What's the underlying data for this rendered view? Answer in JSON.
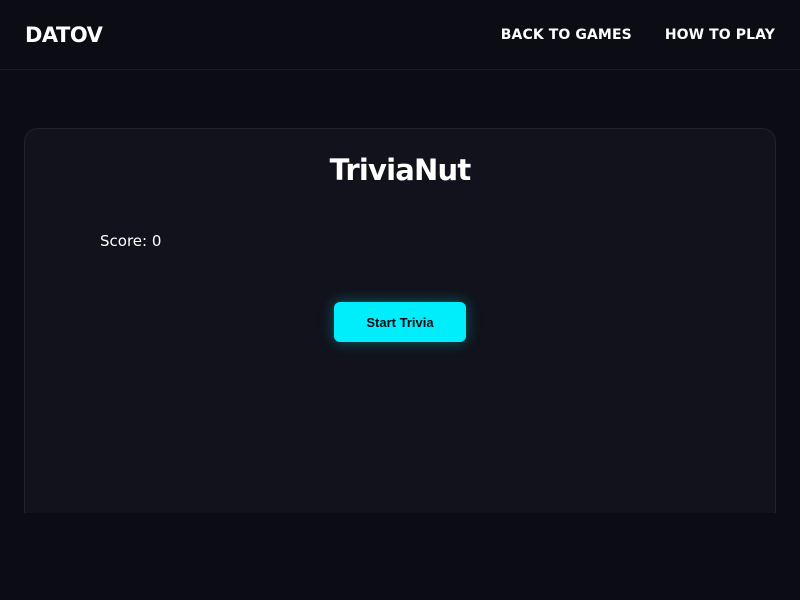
{
  "header": {
    "brand": "DATOV",
    "nav": [
      {
        "label": "BACK TO GAMES"
      },
      {
        "label": "HOW TO PLAY"
      }
    ]
  },
  "game": {
    "title": "TriviaNut",
    "score_label": "Score: 0",
    "start_button_label": "Start Trivia"
  },
  "colors": {
    "background": "#0c0d14",
    "card_background": "#11121b",
    "accent": "#00eefc",
    "text": "#ffffff"
  }
}
